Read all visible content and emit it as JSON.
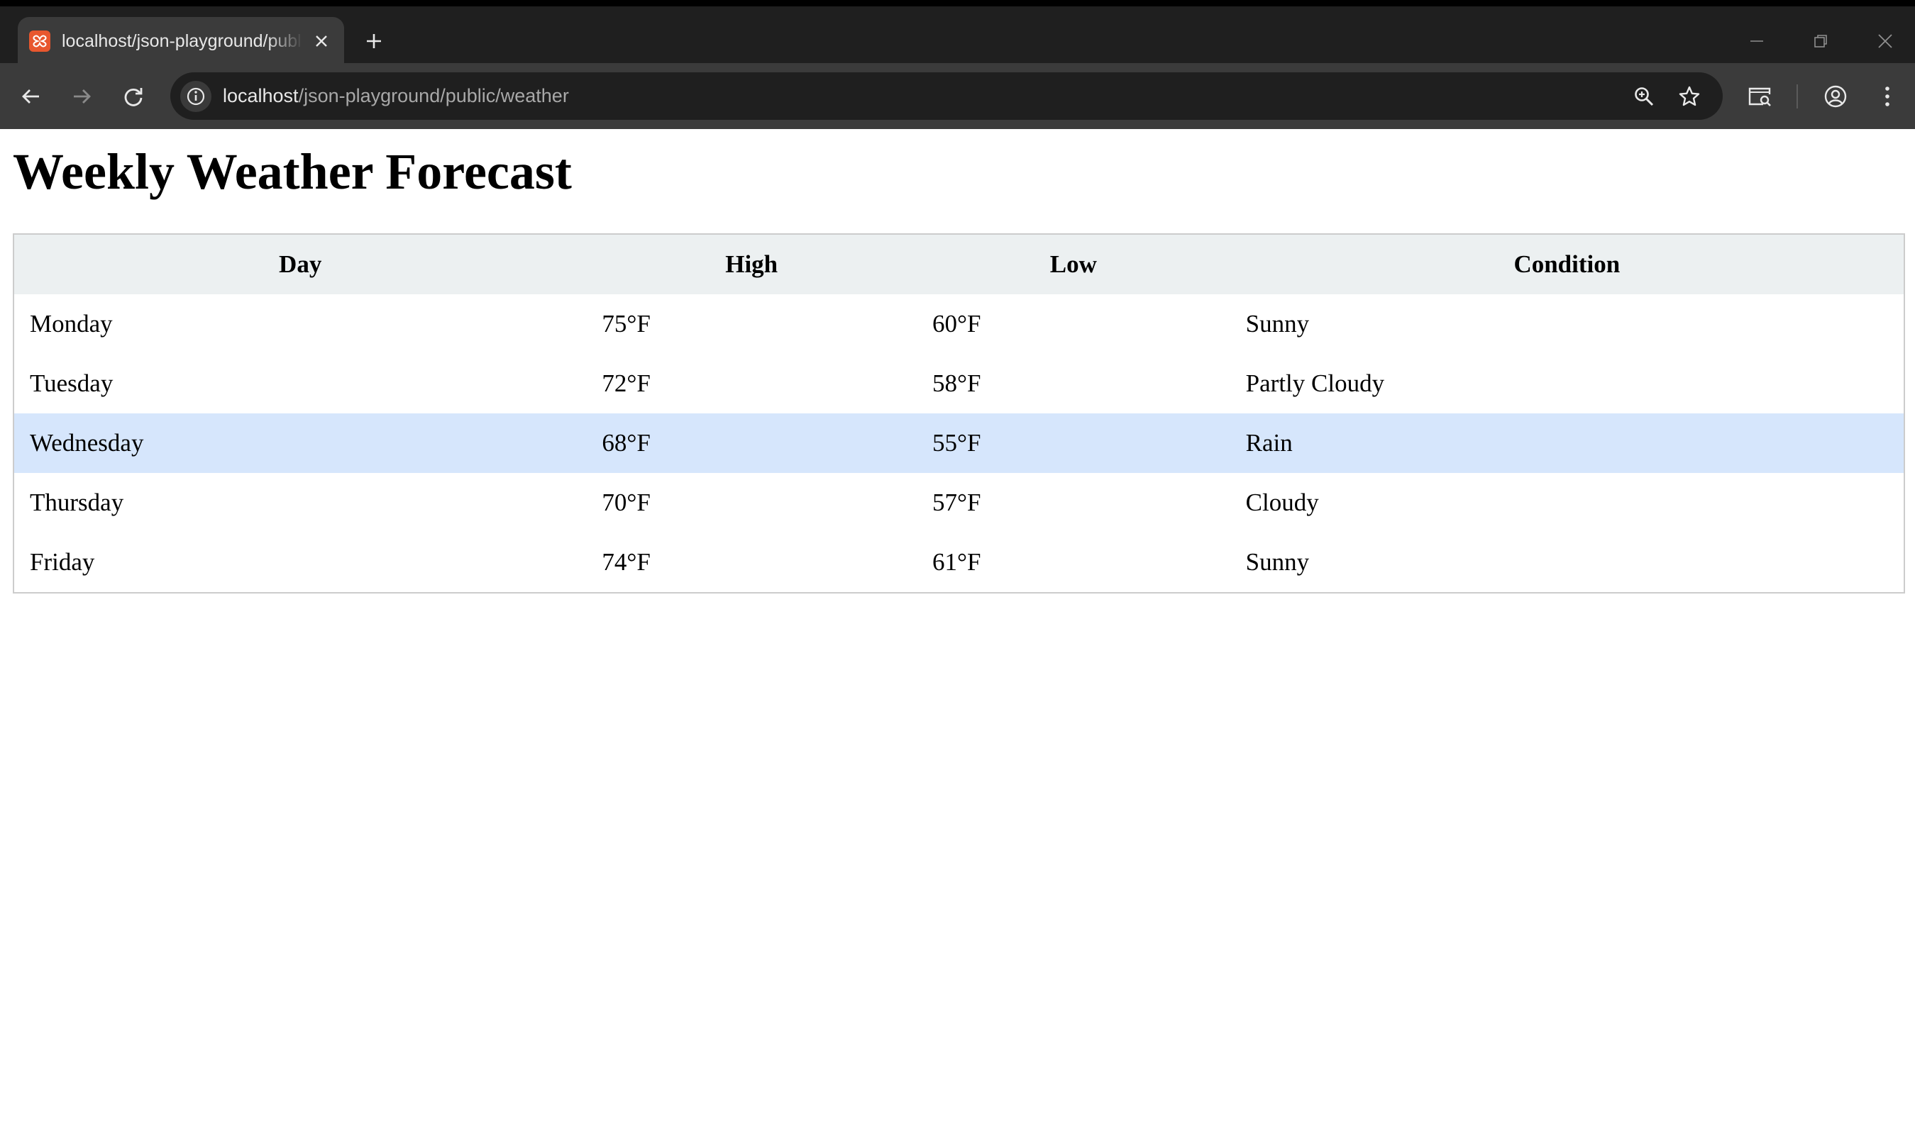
{
  "browser": {
    "tab_title": "localhost/json-playground/public/weather",
    "url_host": "localhost",
    "url_path": "/json-playground/public/weather",
    "icons": {
      "favicon": "xampp-favicon-icon",
      "tab_close": "close-icon",
      "new_tab": "plus-icon",
      "minimize": "minimize-icon",
      "restore": "restore-icon",
      "window_close": "close-icon",
      "back": "back-arrow-icon",
      "forward": "forward-arrow-icon",
      "reload": "reload-icon",
      "site_info": "info-icon",
      "zoom": "zoom-icon",
      "bookmark": "star-icon",
      "reading_mode": "reading-mode-icon",
      "profile": "profile-icon",
      "menu": "more-vert-icon"
    },
    "colors": {
      "tabbar_bg": "#1f1f1f",
      "toolbar_bg": "#3b3b3b",
      "favicon": "#e8572e"
    }
  },
  "page": {
    "title": "Weekly Weather Forecast",
    "table": {
      "headers": [
        "Day",
        "High",
        "Low",
        "Condition"
      ],
      "rows": [
        {
          "day": "Monday",
          "high": "75°F",
          "low": "60°F",
          "condition": "Sunny"
        },
        {
          "day": "Tuesday",
          "high": "72°F",
          "low": "58°F",
          "condition": "Partly Cloudy"
        },
        {
          "day": "Wednesday",
          "high": "68°F",
          "low": "55°F",
          "condition": "Rain",
          "highlighted": true
        },
        {
          "day": "Thursday",
          "high": "70°F",
          "low": "57°F",
          "condition": "Cloudy"
        },
        {
          "day": "Friday",
          "high": "74°F",
          "low": "61°F",
          "condition": "Sunny"
        }
      ]
    },
    "colors": {
      "header_bg": "#ecf0f1",
      "highlight_row": "#d6e6fc",
      "border": "#cccccc"
    }
  }
}
